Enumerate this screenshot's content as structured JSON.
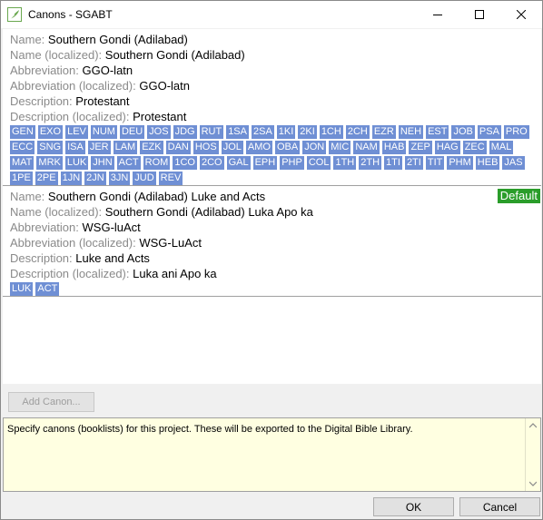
{
  "window": {
    "title": "Canons - SGABT",
    "icon": "paratext-feather-icon",
    "accent_color": "#6f8fd4"
  },
  "canons": [
    {
      "name_label": "Name:",
      "name": "Southern Gondi (Adilabad)",
      "name_localized_label": "Name (localized):",
      "name_localized": "Southern Gondi (Adilabad)",
      "abbreviation_label": "Abbreviation:",
      "abbreviation": "GGO-latn",
      "abbreviation_localized_label": "Abbreviation (localized):",
      "abbreviation_localized": "GGO-latn",
      "description_label": "Description:",
      "description": "Protestant",
      "description_localized_label": "Description (localized):",
      "description_localized": "Protestant",
      "books": [
        "GEN",
        "EXO",
        "LEV",
        "NUM",
        "DEU",
        "JOS",
        "JDG",
        "RUT",
        "1SA",
        "2SA",
        "1KI",
        "2KI",
        "1CH",
        "2CH",
        "EZR",
        "NEH",
        "EST",
        "JOB",
        "PSA",
        "PRO",
        "ECC",
        "SNG",
        "ISA",
        "JER",
        "LAM",
        "EZK",
        "DAN",
        "HOS",
        "JOL",
        "AMO",
        "OBA",
        "JON",
        "MIC",
        "NAM",
        "HAB",
        "ZEP",
        "HAG",
        "ZEC",
        "MAL",
        "MAT",
        "MRK",
        "LUK",
        "JHN",
        "ACT",
        "ROM",
        "1CO",
        "2CO",
        "GAL",
        "EPH",
        "PHP",
        "COL",
        "1TH",
        "2TH",
        "1TI",
        "2TI",
        "TIT",
        "PHM",
        "HEB",
        "JAS",
        "1PE",
        "2PE",
        "1JN",
        "2JN",
        "3JN",
        "JUD",
        "REV"
      ]
    },
    {
      "name_label": "Name:",
      "name": "Southern Gondi (Adilabad) Luke and Acts",
      "name_localized_label": "Name (localized):",
      "name_localized": "Southern Gondi (Adilabad) Luka Apo ka",
      "abbreviation_label": "Abbreviation:",
      "abbreviation": "WSG-luAct",
      "abbreviation_localized_label": "Abbreviation (localized):",
      "abbreviation_localized": "WSG-LuAct",
      "description_label": "Description:",
      "description": "Luke and Acts",
      "description_localized_label": "Description (localized):",
      "description_localized": "Luka ani Apo ka",
      "badge": "Default",
      "badge_color": "#2a9d2a",
      "books": [
        "LUK",
        "ACT"
      ]
    }
  ],
  "add_canon_label": "Add Canon...",
  "help_text": "Specify canons (booklists) for this project. These will be exported to the Digital Bible Library.",
  "ok_label": "OK",
  "cancel_label": "Cancel"
}
